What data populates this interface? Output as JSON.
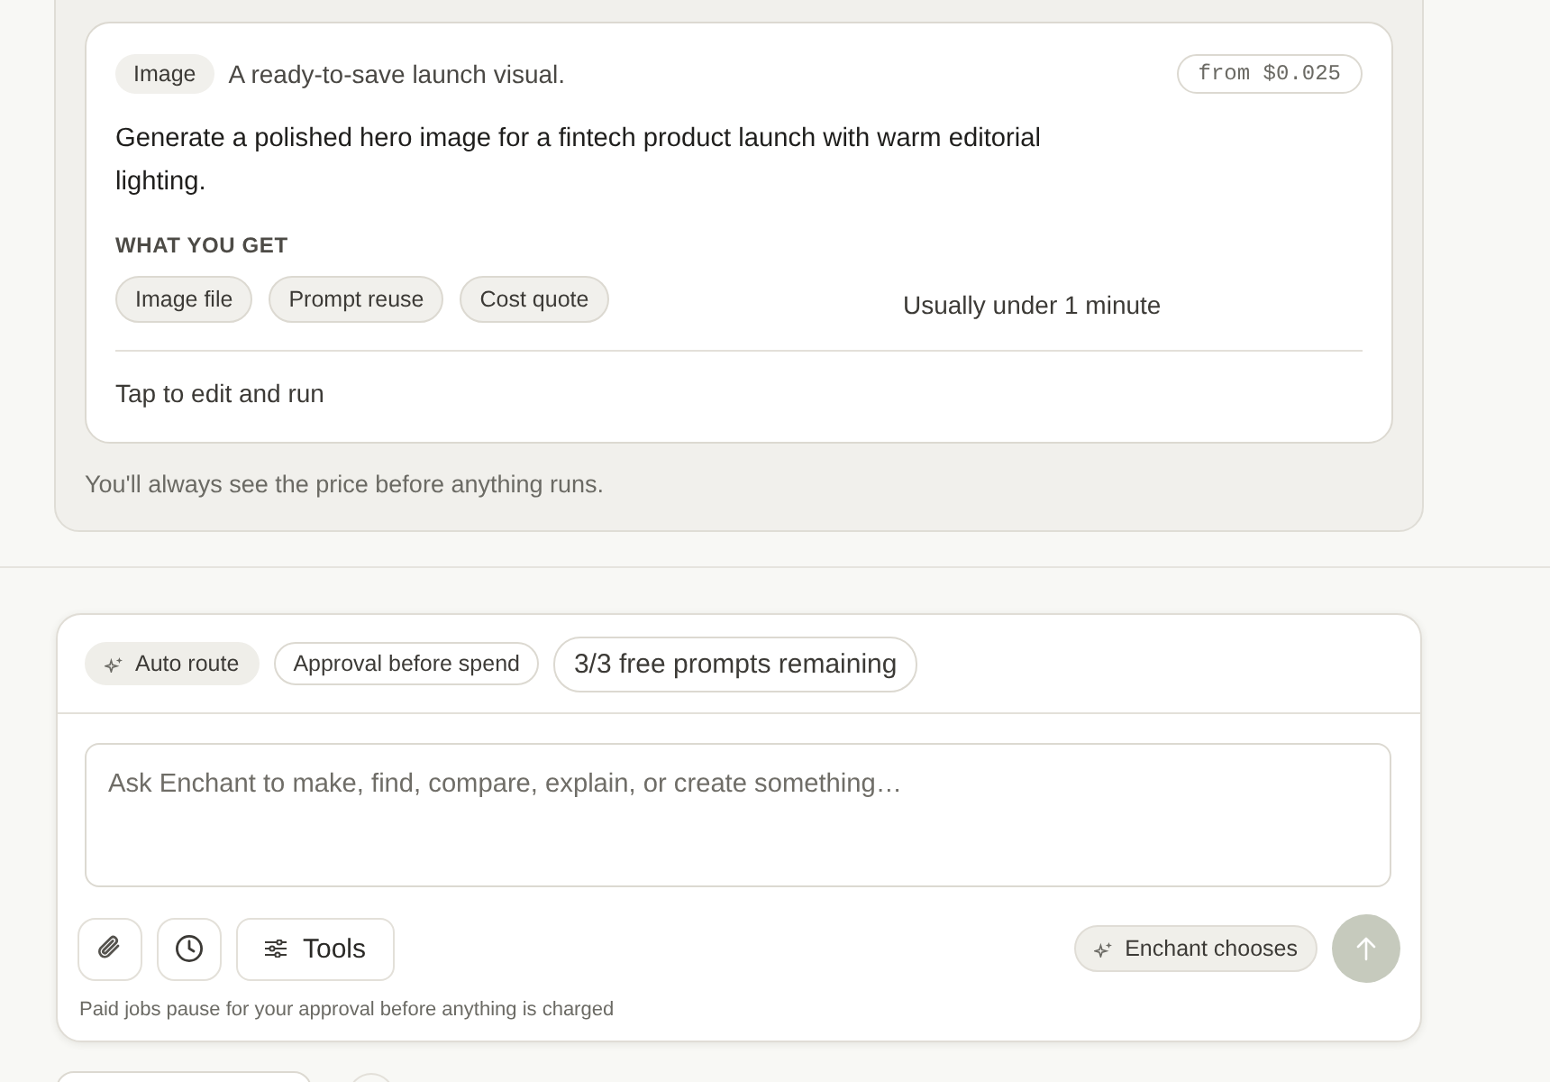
{
  "result_panel": {
    "card": {
      "type_badge": "Image",
      "subtitle": "A ready-to-save launch visual.",
      "price": "from $0.025",
      "prompt": "Generate a polished hero image for a fintech product launch with warm editorial lighting.",
      "section_label": "WHAT YOU GET",
      "deliverables": [
        "Image file",
        "Prompt reuse",
        "Cost quote"
      ],
      "eta": "Usually under 1 minute",
      "action": "Tap to edit and run"
    },
    "note": "You'll always see the price before anything runs."
  },
  "composer": {
    "chips": [
      {
        "kind": "route",
        "label": "Auto route"
      },
      {
        "kind": "outline",
        "label": "Approval before spend"
      },
      {
        "kind": "quota",
        "label": "3/3 free prompts remaining"
      }
    ],
    "input": {
      "placeholder": "Ask Enchant to make, find, compare, explain, or create something…"
    },
    "tools_button": "Tools",
    "model_chip": "Enchant chooses",
    "send": {
      "disabled": true
    },
    "footnote": "Paid jobs pause for your approval before anything is charged"
  }
}
